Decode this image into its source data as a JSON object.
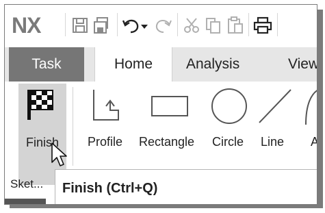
{
  "app": {
    "logo": "NX"
  },
  "quick_access": {
    "icons": [
      "save-icon",
      "save-all-icon",
      "undo-icon",
      "undo-dropdown-icon",
      "redo-icon",
      "cut-icon",
      "copy-icon",
      "paste-icon",
      "print-icon"
    ]
  },
  "tabs": [
    {
      "label": "Task",
      "state": "highlighted"
    },
    {
      "label": "Home",
      "state": "selected"
    },
    {
      "label": "Analysis",
      "state": "normal"
    },
    {
      "label": "View",
      "state": "normal"
    }
  ],
  "ribbon": {
    "finish": {
      "label": "Finish",
      "icon": "checkered-flag-icon"
    },
    "tools": [
      {
        "label": "Profile",
        "icon": "profile-icon"
      },
      {
        "label": "Rectangle",
        "icon": "rectangle-icon"
      },
      {
        "label": "Circle",
        "icon": "circle-icon"
      },
      {
        "label": "Line",
        "icon": "line-icon"
      },
      {
        "label": "A",
        "icon": "arc-icon"
      }
    ]
  },
  "sketch_label": "Sket...",
  "tooltip": {
    "text": "Finish (Ctrl+Q)"
  },
  "colors": {
    "task_tab_bg": "#767676",
    "finish_bg": "#d4d4d4",
    "tab_row_bg": "#e6e6e6"
  }
}
